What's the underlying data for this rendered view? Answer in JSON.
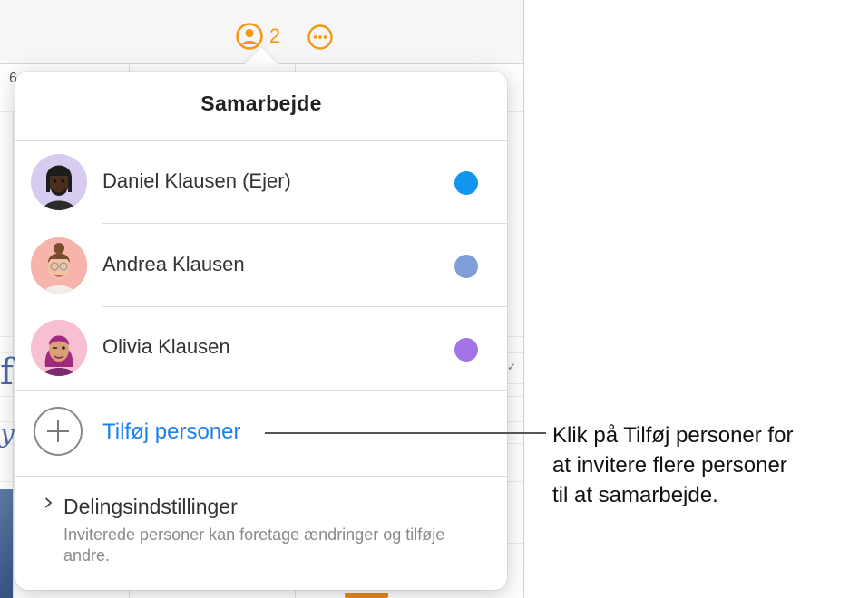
{
  "toolbar": {
    "collaborator_count": "2",
    "collaborators_icon": "person-circle-icon",
    "more_icon": "ellipsis-circle-icon",
    "accent_color": "#f29a13"
  },
  "background": {
    "ruler_number": "6"
  },
  "popover": {
    "title": "Samarbejde",
    "participants": [
      {
        "name": "Daniel Klausen (Ejer)",
        "color": "#1196f0",
        "avatar": "memoji-daniel"
      },
      {
        "name": "Andrea Klausen",
        "color": "#7f9ed8",
        "avatar": "memoji-andrea"
      },
      {
        "name": "Olivia Klausen",
        "color": "#a374e8",
        "avatar": "memoji-olivia"
      }
    ],
    "add_people": {
      "label": "Tilføj personer",
      "icon": "plus-circle-icon"
    },
    "sharing_settings": {
      "title": "Delingsindstillinger",
      "description": "Inviterede personer kan foretage ændringer og tilføje andre.",
      "icon": "chevron-right-icon"
    }
  },
  "callout": {
    "text_line1": "Klik på Tilføj personer for",
    "text_line2": "at invitere flere personer",
    "text_line3": "til at samarbejde."
  }
}
